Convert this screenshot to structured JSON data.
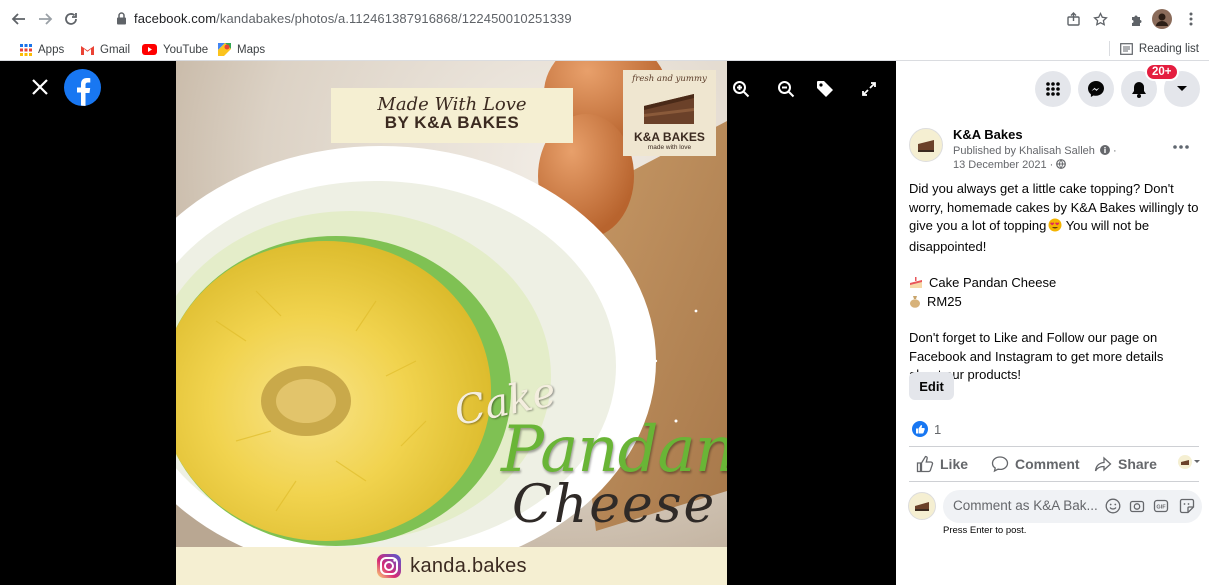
{
  "browser": {
    "url_host": "facebook.com",
    "url_path": "/kandabakes/photos/a.112461387916868/122450010251339",
    "bookmarks": [
      {
        "label": "Apps"
      },
      {
        "label": "Gmail"
      },
      {
        "label": "YouTube"
      },
      {
        "label": "Maps"
      }
    ],
    "reading_list": "Reading list"
  },
  "photo": {
    "headline_script": "Made With Love",
    "headline_bold": "BY K&A BAKES",
    "badge_top": "fresh and yummy",
    "badge_name": "K&A BAKES",
    "badge_sub": "made with love",
    "cake_word": "Cake",
    "pandan_word": "Pandan",
    "cheese_word": "Cheese",
    "instagram_handle": "kanda.bakes"
  },
  "sidebar": {
    "notifications_count": "20+",
    "page_name": "K&A Bakes",
    "published_by": "Published by Khalisah Salleh",
    "date": "13 December 2021 ·",
    "post_paragraph_1": "Did you always get a little cake topping? Don't worry, homemade cakes by K&A Bakes willingly to give you a lot of topping",
    "post_paragraph_1_end": " You will not be disappointed!",
    "item_name": "Cake Pandan Cheese",
    "item_price": "RM25",
    "post_paragraph_2": "Don't forget to Like and Follow our page on Facebook and Instagram to get more details about our products!",
    "edit_label": "Edit",
    "like_count": "1",
    "actions": {
      "like": "Like",
      "comment": "Comment",
      "share": "Share"
    },
    "comment_placeholder": "Comment as K&A Bak...",
    "press_enter": "Press Enter to post."
  },
  "colors": {
    "facebook_blue": "#1877f2",
    "notification_red": "#e41e3f",
    "pandan_green": "#69b536"
  }
}
